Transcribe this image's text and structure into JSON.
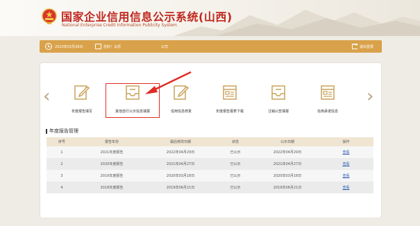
{
  "header": {
    "title": "国家企业信用信息公示系统(山西)",
    "subtitle": "National Enterprise Credit Information Publicity System"
  },
  "infobar": {
    "date": "2023年03月28日",
    "user": "您好！太原",
    "company": "公司",
    "logout": "退出登录"
  },
  "functions": [
    {
      "label": "年度报告填写",
      "icon": "edit-icon"
    },
    {
      "label": "其他自行公示信息填报",
      "icon": "inbox-icon"
    },
    {
      "label": "信用信息修复",
      "icon": "edit-icon"
    },
    {
      "label": "年度报告报表下载",
      "icon": "form-icon"
    },
    {
      "label": "注销公告填报",
      "icon": "inbox-icon"
    },
    {
      "label": "信用承诺信息",
      "icon": "form-icon"
    }
  ],
  "section_title": "年度报告管理",
  "table": {
    "headers": [
      "序号",
      "报告年份",
      "最后修改日期",
      "状态",
      "公示日期",
      "操作"
    ],
    "rows": [
      [
        "1",
        "2021年度报告",
        "2022年04月29日",
        "已公示",
        "2022年04月29日",
        "查看"
      ],
      [
        "2",
        "2020年度报告",
        "2021年04月27日",
        "已公示",
        "2021年04月27日",
        "查看"
      ],
      [
        "3",
        "2019年度报告",
        "2020年03月18日",
        "已公示",
        "2020年03月18日",
        "查看"
      ],
      [
        "4",
        "2018年度报告",
        "2019年06月21日",
        "已公示",
        "2019年06月21日",
        "查看"
      ]
    ]
  },
  "colors": {
    "title_red": "#c0271e",
    "bar_gold": "#d9a24a",
    "icon_gold": "#c9a25a",
    "highlight_red": "#e12a23",
    "link_blue": "#2c5bb6"
  }
}
